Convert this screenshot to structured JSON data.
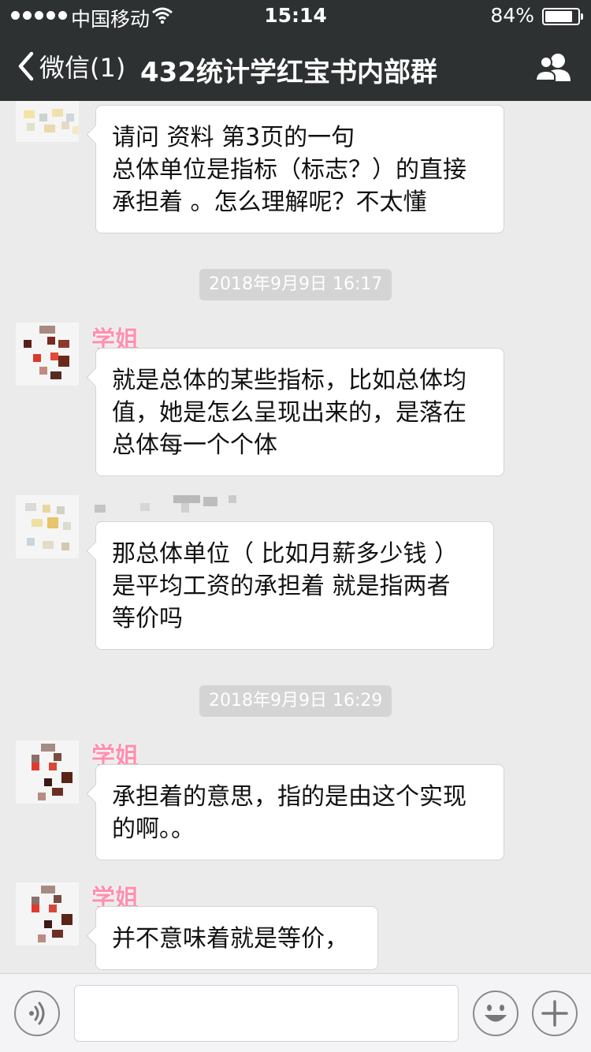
{
  "status_bar": {
    "carrier": "中国移动",
    "time": "15:14",
    "battery_percent": "84%",
    "battery_level": 0.84
  },
  "nav": {
    "back_label": "微信(1)",
    "title": "432统计学红宝书内部群",
    "back_icon": "chevron-left-icon",
    "group_icon": "group-members-icon"
  },
  "messages": [
    {
      "type": "bubble",
      "sender": "",
      "lines": [
        "请问 资料 第3页的一句",
        "总体单位是指标（标志？）的直接",
        "承担着 。怎么理解呢？不太懂"
      ]
    },
    {
      "type": "time",
      "text": "2018年9月9日 16:17"
    },
    {
      "type": "bubble",
      "sender": "学姐",
      "lines": [
        "就是总体的某些指标，比如总体均",
        "值，她是怎么呈现出来的，是落在",
        "总体每一个个体"
      ]
    },
    {
      "type": "bubble",
      "sender": "",
      "lines": [
        "那总体单位（ 比如月薪多少钱 ）",
        "是平均工资的承担着 就是指两者",
        "等价吗"
      ]
    },
    {
      "type": "time",
      "text": "2018年9月9日 16:29"
    },
    {
      "type": "bubble",
      "sender": "学姐",
      "lines": [
        "承担着的意思，指的是由这个实现",
        "的啊。。"
      ]
    },
    {
      "type": "bubble",
      "sender": "学姐",
      "lines": [
        "并不意味着就是等价，"
      ]
    }
  ],
  "input_bar": {
    "voice_icon": "voice-icon",
    "emoji_icon": "emoji-icon",
    "plus_icon": "plus-icon"
  },
  "colors": {
    "nav_background": "#2e3132",
    "chat_background": "#ebebeb",
    "nickname": "#ff8fae",
    "time_pill": "#d4d4d4"
  }
}
